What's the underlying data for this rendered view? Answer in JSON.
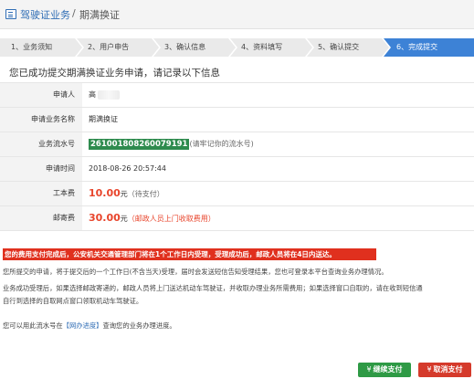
{
  "header": {
    "breadcrumb_main": "驾驶证业务",
    "breadcrumb_sep": "/",
    "breadcrumb_sub": "期满换证"
  },
  "steps": [
    {
      "label": "1、业务须知",
      "active": false
    },
    {
      "label": "2、用户申告",
      "active": false
    },
    {
      "label": "3、确认信息",
      "active": false
    },
    {
      "label": "4、资料填写",
      "active": false
    },
    {
      "label": "5、确认提交",
      "active": false
    },
    {
      "label": "6、完成提交",
      "active": true
    }
  ],
  "success_message": "您已成功提交期满换证业务申请，请记录以下信息",
  "info": {
    "applicant_label": "申请人",
    "applicant_value": "高",
    "business_label": "申请业务名称",
    "business_value": "期满换证",
    "serial_label": "业务流水号",
    "serial_value": "2610018082600791​91",
    "serial_note": "(请牢记你的流水号)",
    "time_label": "申请时间",
    "time_value": "2018-08-26 20:57:44",
    "fee_label": "工本费",
    "fee_value": "10.00",
    "fee_unit": "元",
    "fee_status": "（待支付）",
    "postage_label": "邮寄费",
    "postage_value": "30.00",
    "postage_unit": "元",
    "postage_note": "（邮政人员上门收取费用）"
  },
  "notice": "您的费用支付完成后，公安机关交通管理部门将在1个工作日内受理，受理成功后，邮政人员将在4日内送达。",
  "paragraphs": {
    "p1": "您所提交的申请，将于提交后的一个工作日(不含当天)受理，届时会发送短信告知受理结果，您也可登录本平台查询业务办理情况。",
    "p2a": "业务成功受理后，如果选择邮政寄递的，邮政人员将上门送达机动车驾驶证，并收取办理业务所需费用；如果选择窗口自取的，请在收到短信通",
    "p2b": "自行到选择的自取网点窗口领取机动车驾驶证。",
    "p3_prefix": "您可以用此流水号在",
    "p3_link": "【网办进度】",
    "p3_suffix": "查询您的业务办理进度。"
  },
  "buttons": {
    "continue_label": "继续支付",
    "cancel_label": "取消支付"
  },
  "colors": {
    "primary": "#3d82d6",
    "success": "#2e9a45",
    "danger": "#d53a2b",
    "serial_bg": "#2e8b4e",
    "amount": "#e8452c"
  }
}
